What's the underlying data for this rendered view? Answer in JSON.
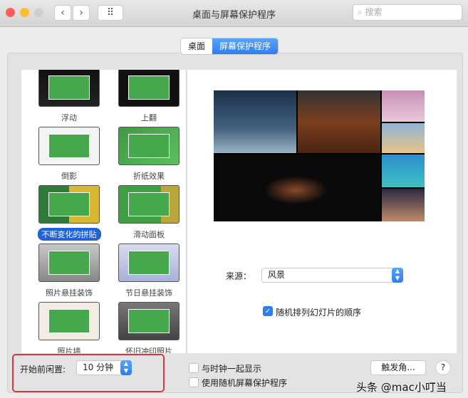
{
  "window": {
    "title": "桌面与屏幕保护程序",
    "search_placeholder": "搜索",
    "back": "‹",
    "forward": "›",
    "grid": "⠿"
  },
  "tabs": [
    {
      "label": "桌面",
      "selected": false
    },
    {
      "label": "屏幕保护程序",
      "selected": true
    }
  ],
  "savers": [
    {
      "label": "浮动",
      "selected": false
    },
    {
      "label": "上翻",
      "selected": false
    },
    {
      "label": "倒影",
      "selected": false
    },
    {
      "label": "折纸效果",
      "selected": false
    },
    {
      "label": "不断变化的拼贴",
      "selected": true
    },
    {
      "label": "滑动面板",
      "selected": false
    },
    {
      "label": "照片悬挂装饰",
      "selected": false
    },
    {
      "label": "节日悬挂装饰",
      "selected": false
    },
    {
      "label": "照片墙",
      "selected": false
    },
    {
      "label": "怀旧冲印照片",
      "selected": false
    }
  ],
  "options": {
    "source_label": "来源：",
    "source_value": "风景",
    "shuffle_label": "随机排列幻灯片的顺序",
    "shuffle_checked": true
  },
  "bottom": {
    "idle_label": "开始前闲置:",
    "idle_value": "10 分钟",
    "clock_label": "与时钟一起显示",
    "clock_checked": false,
    "random_label": "使用随机屏幕保护程序",
    "random_checked": false,
    "hot_corners": "触发角...",
    "help": "?"
  },
  "watermark": "头条 @mac小叮当",
  "colors": {
    "accent": "#2e7ef0",
    "highlight_box": "#d9363e"
  }
}
